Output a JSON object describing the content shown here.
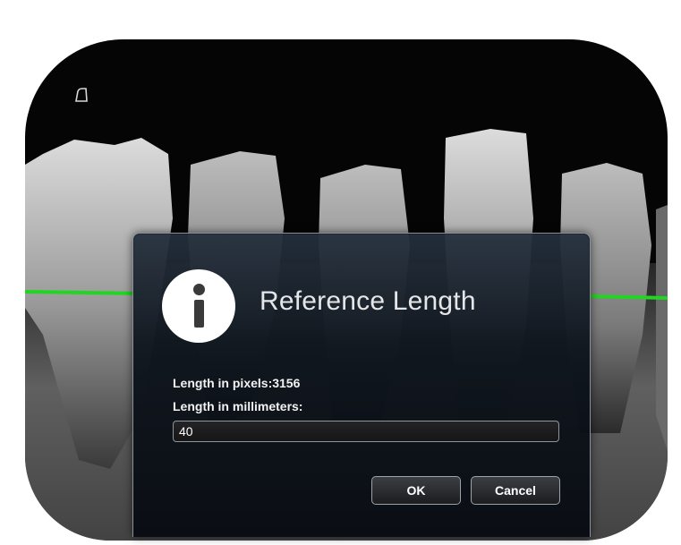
{
  "dialog": {
    "title": "Reference Length",
    "pixels_label": "Length in pixels:3156",
    "mm_label": "Length in millimeters:",
    "mm_value": "40",
    "ok_label": "OK",
    "cancel_label": "Cancel"
  },
  "icons": {
    "info": "info-icon",
    "corner_marker": "corner-marker-icon"
  },
  "colors": {
    "measurement_line": "#21d621",
    "dialog_background": "#0f161e",
    "xray_background": "#050505"
  }
}
